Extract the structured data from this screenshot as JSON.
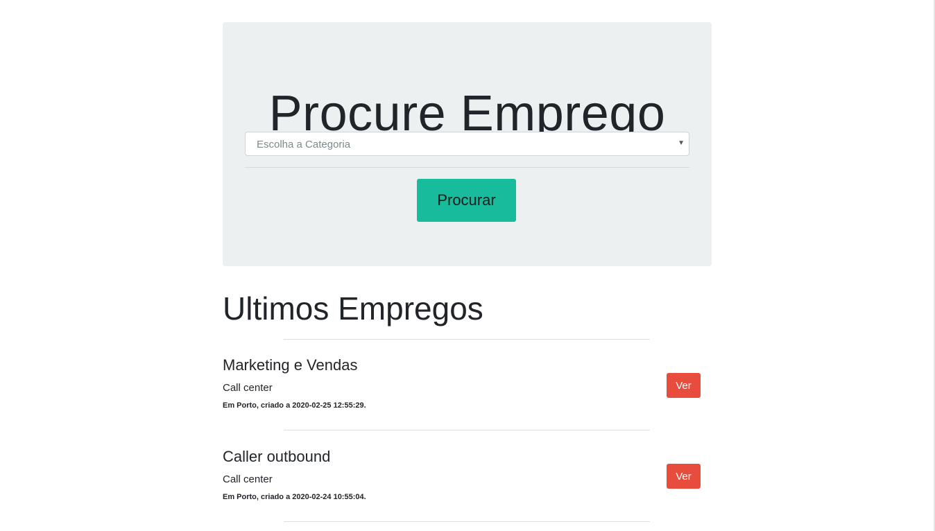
{
  "hero": {
    "title": "Procure Emprego",
    "category_select_value": "Escolha a Categoria",
    "search_button_label": "Procurar"
  },
  "latest": {
    "title": "Ultimos Empregos",
    "jobs": [
      {
        "title": "Marketing e Vendas",
        "category": "Call center",
        "meta": "Em Porto, criado a 2020-02-25 12:55:29.",
        "view_label": "Ver"
      },
      {
        "title": "Caller outbound",
        "category": "Call center",
        "meta": "Em Porto, criado a 2020-02-24 10:55:04.",
        "view_label": "Ver"
      }
    ]
  },
  "colors": {
    "jumbotron_bg": "#ecf0f1",
    "primary_button": "#18bc9c",
    "danger_button": "#e74c3c"
  },
  "icons": {
    "select_caret": "caret-down-icon"
  }
}
